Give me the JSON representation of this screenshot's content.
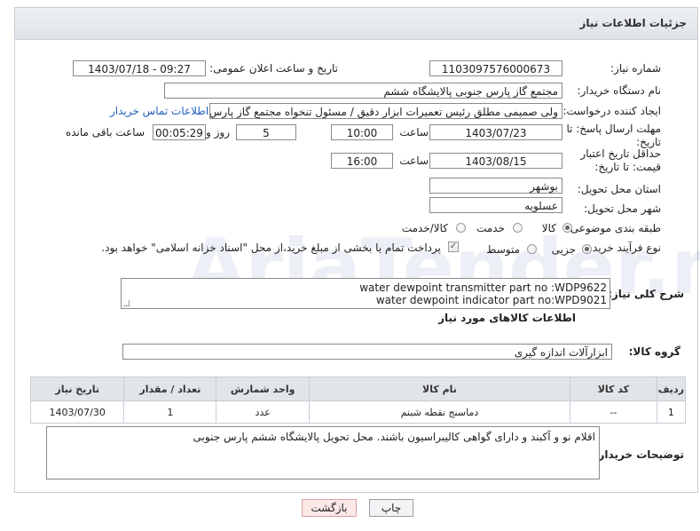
{
  "header": {
    "title": "جزئیات اطلاعات نیاز"
  },
  "fields": {
    "need_number_label": "شماره نیاز:",
    "need_number": "1103097576000673",
    "announce_label": "تاریخ و ساعت اعلان عمومی:",
    "announce_value": "1403/07/18 - 09:27",
    "buyer_org_label": "نام دستگاه خریدار:",
    "buyer_org": "مجتمع گاز پارس جنوبی  پالایشگاه ششم",
    "creator_label": "ایجاد کننده درخواست:",
    "creator": "ولی صمیمی مطلق رئیس تعمیرات ابزار دقیق / مسئول تنخواه مجتمع گاز پارس جنوبی",
    "contact_link": "اطلاعات تماس خریدار",
    "reply_deadline_label": "مهلت ارسال پاسخ: تا تاریخ:",
    "reply_date": "1403/07/23",
    "time_label": "ساعت",
    "reply_time": "10:00",
    "days_value": "5",
    "days_label": "روز و",
    "remaining_time": "00:05:29",
    "remaining_label": "ساعت باقی مانده",
    "price_validity_label": "حداقل تاریخ اعتبار قیمت: تا تاریخ:",
    "validity_date": "1403/08/15",
    "validity_time": "16:00",
    "province_label": "استان محل تحویل:",
    "province": "بوشهر",
    "city_label": "شهر محل تحویل:",
    "city": "عسلویه",
    "category_label": "طبقه بندی موضوعی:",
    "category_options": [
      "کالا",
      "خدمت",
      "کالا/خدمت"
    ],
    "process_label": "نوع فرآیند خرید :",
    "process_options": [
      "جزیی",
      "متوسط"
    ],
    "payment_note": "پرداخت تمام یا بخشی از مبلغ خرید،از محل \"اسناد خزانه اسلامی\" خواهد بود.",
    "summary_label": "شرح کلی نیاز:",
    "summary_line1": "water dewpoint transmitter part no :WDP9622",
    "summary_line2": "water dewpoint indicator  part no:WPD9021",
    "goods_info_title": "اطلاعات کالاهای مورد نیاز",
    "goods_group_label": "گروه کالا:",
    "goods_group": "ابزارآلات اندازه گیری",
    "buyer_notes_label": "توضیحات خریدار:",
    "buyer_notes": "اقلام نو و آکبند و دارای گواهی کالیبراسیون باشند. محل تحویل پالایشگاه ششم پارس جنوبی"
  },
  "table": {
    "headers": [
      "ردیف",
      "کد کالا",
      "نام کالا",
      "واحد شمارش",
      "تعداد / مقدار",
      "تاریخ نیاز"
    ],
    "rows": [
      [
        "1",
        "--",
        "دماسنج نقطه شبنم",
        "عدد",
        "1",
        "1403/07/30"
      ]
    ]
  },
  "buttons": {
    "print": "چاپ",
    "back": "بازگشت"
  },
  "watermark": {
    "text": "AriaTender.net"
  },
  "colors": {
    "link": "#1f5fbf",
    "header_bg": "#e3e6ea",
    "back_button_bg": "#fde8e8"
  }
}
